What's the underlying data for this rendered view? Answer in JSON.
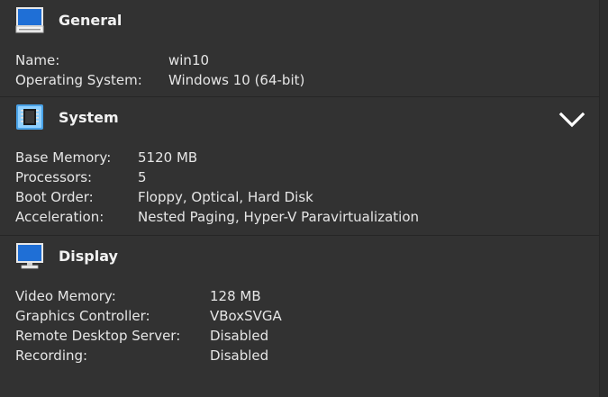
{
  "general": {
    "title": "General",
    "icon": "monitor-icon",
    "rows": [
      {
        "label": "Name:",
        "value": "win10"
      },
      {
        "label": "Operating System:",
        "value": "Windows 10 (64-bit)"
      }
    ]
  },
  "system": {
    "title": "System",
    "icon": "chip-icon",
    "collapse_icon": "chevron-down-icon",
    "rows": [
      {
        "label": "Base Memory:",
        "value": "5120 MB"
      },
      {
        "label": "Processors:",
        "value": "5"
      },
      {
        "label": "Boot Order:",
        "value": "Floppy, Optical, Hard Disk"
      },
      {
        "label": "Acceleration:",
        "value": "Nested Paging, Hyper-V Paravirtualization"
      }
    ]
  },
  "display": {
    "title": "Display",
    "icon": "display-icon",
    "rows": [
      {
        "label": "Video Memory:",
        "value": "128 MB"
      },
      {
        "label": "Graphics Controller:",
        "value": "VBoxSVGA"
      },
      {
        "label": "Remote Desktop Server:",
        "value": "Disabled"
      },
      {
        "label": "Recording:",
        "value": "Disabled"
      }
    ]
  },
  "colors": {
    "background": "#323232",
    "accent": "#1f6fd6",
    "text": "#ececec"
  }
}
